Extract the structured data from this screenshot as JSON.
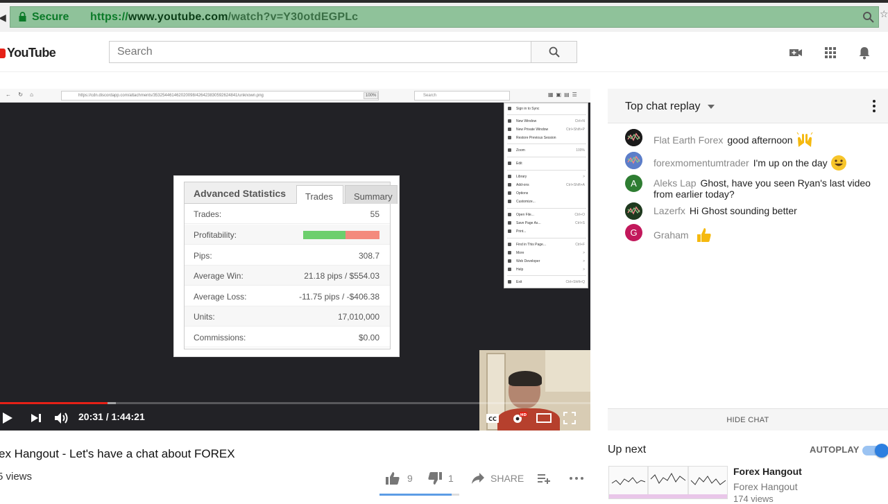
{
  "browser": {
    "secure_label": "Secure",
    "url_scheme": "https://",
    "url_host": "www.youtube.com",
    "url_path": "/watch?v=Y30otdEGPLc"
  },
  "header": {
    "logo_text": "YouTube",
    "search_placeholder": "Search"
  },
  "player": {
    "inner_url": "https://cdn.discordapp.com/attachments/353254461462020098/426423830592624841/unknown.png",
    "inner_zoom": "100%",
    "inner_search_placeholder": "Search",
    "time_display": "20:31 / 1:44:21",
    "progress_played_fraction": 0.182,
    "progress_buffered_fraction": 0.196,
    "stats": {
      "title": "Advanced Statistics",
      "tab_trades": "Trades",
      "tab_summary": "Summary",
      "rows": [
        {
          "label": "Trades:",
          "value": "55"
        },
        {
          "label": "Profitability:",
          "value": ""
        },
        {
          "label": "Pips:",
          "value": "308.7"
        },
        {
          "label": "Average Win:",
          "value": "21.18 pips / $554.03"
        },
        {
          "label": "Average Loss:",
          "value": "-11.75 pips / -$406.38"
        },
        {
          "label": "Units:",
          "value": "17,010,000"
        },
        {
          "label": "Commissions:",
          "value": "$0.00"
        }
      ],
      "profitability_win_fraction": 0.55
    },
    "ff_menu": [
      {
        "label": "Sign in to Sync",
        "key": ""
      },
      {
        "label": "New Window",
        "key": "Ctrl+N"
      },
      {
        "label": "New Private Window",
        "key": "Ctrl+Shift+P"
      },
      {
        "label": "Restore Previous Session",
        "key": ""
      },
      {
        "label": "Zoom",
        "key": "100%"
      },
      {
        "label": "Edit",
        "key": ""
      },
      {
        "label": "Library",
        "key": ">"
      },
      {
        "label": "Add-ons",
        "key": "Ctrl+Shift+A"
      },
      {
        "label": "Options",
        "key": ""
      },
      {
        "label": "Customize...",
        "key": ""
      },
      {
        "label": "Open File...",
        "key": "Ctrl+O"
      },
      {
        "label": "Save Page As...",
        "key": "Ctrl+S"
      },
      {
        "label": "Print...",
        "key": ""
      },
      {
        "label": "Find in This Page...",
        "key": "Ctrl+F"
      },
      {
        "label": "More",
        "key": ">"
      },
      {
        "label": "Web Developer",
        "key": ">"
      },
      {
        "label": "Help",
        "key": ">"
      },
      {
        "label": "Exit",
        "key": "Ctrl+Shift+Q"
      }
    ]
  },
  "video": {
    "title": "ex Hangout - Let's have a chat about FOREX",
    "views": "5 views",
    "likes": "9",
    "dislikes": "1",
    "share_label": "SHARE",
    "like_fraction": 0.9
  },
  "chat": {
    "title": "Top chat replay",
    "hide_label": "HIDE CHAT",
    "messages": [
      {
        "author": "Flat Earth Forex",
        "text": "good afternoon",
        "emoji": "raised-hands",
        "avatar_color": "#1b1b1b",
        "initial": ""
      },
      {
        "author": "forexmomentumtrader",
        "text": "I'm up on the day",
        "emoji": "smiley",
        "avatar_color": "#5c7ec9",
        "initial": ""
      },
      {
        "author": "Aleks Lap",
        "text": "Ghost, have you seen Ryan's last video from earlier today?",
        "emoji": "",
        "avatar_color": "#2e7d32",
        "initial": "A"
      },
      {
        "author": "Lazerfx",
        "text": "Hi Ghost sounding better",
        "emoji": "",
        "avatar_color": "#1f3a1f",
        "initial": ""
      },
      {
        "author": "Graham",
        "text": "",
        "emoji": "thumbs-up",
        "avatar_color": "#c2185b",
        "initial": "G"
      }
    ]
  },
  "upnext": {
    "label": "Up next",
    "autoplay_label": "AUTOPLAY",
    "autoplay_on": true,
    "video_title": "Forex Hangout",
    "channel": "Forex Hangout",
    "views": "174 views"
  }
}
